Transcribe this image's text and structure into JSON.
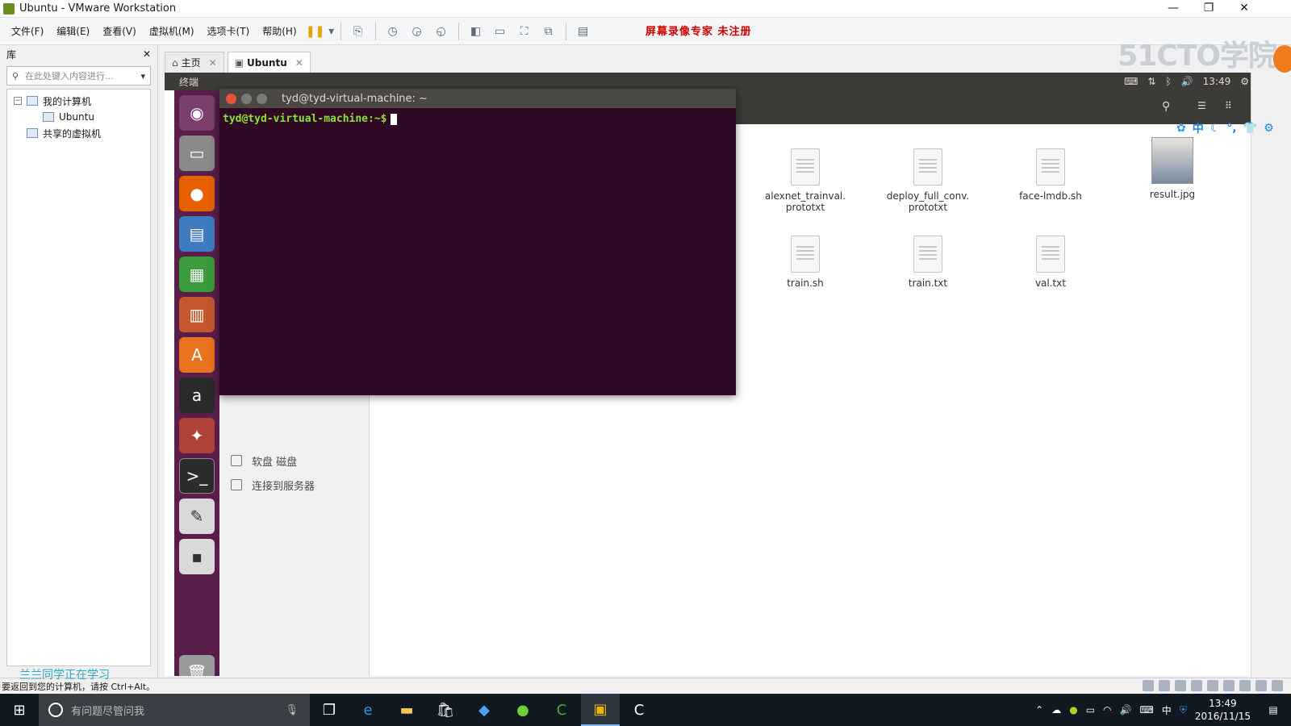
{
  "window": {
    "title": "Ubuntu - VMware Workstation",
    "controls": [
      "—",
      "❐",
      "✕"
    ]
  },
  "menu": {
    "items": [
      "文件(F)",
      "编辑(E)",
      "查看(V)",
      "虚拟机(M)",
      "选项卡(T)",
      "帮助(H)"
    ],
    "recorder_text": "屏幕录像专家  未注册",
    "watermark": "51CTO学院"
  },
  "library": {
    "title": "库",
    "close": "✕",
    "search_placeholder": "在此处键入内容进行...",
    "tree": {
      "root": "我的计算机",
      "vm": "Ubuntu",
      "shared": "共享的虚拟机"
    }
  },
  "tabs": [
    {
      "label": "主页",
      "icon": "⌂"
    },
    {
      "label": "Ubuntu",
      "icon": "▣"
    }
  ],
  "ubuntu": {
    "top_app_name": "终端",
    "time": "13:49",
    "terminal_title": "tyd@tyd-virtual-machine: ~",
    "prompt": "tyd@tyd-virtual-machine:~$",
    "sidebar": [
      "软盘 磁盘",
      "连接到服务器"
    ],
    "files": [
      {
        "name": "alexnet_trainval.\nprototxt"
      },
      {
        "name": "deploy_full_conv.\nprototxt"
      },
      {
        "name": "face-lmdb.sh"
      },
      {
        "name": "result.jpg"
      },
      {
        "name": "train.sh"
      },
      {
        "name": "train.txt"
      },
      {
        "name": "val.txt"
      }
    ],
    "ime_label": "中"
  },
  "status": {
    "hint": "要返回到您的计算机，请按 Ctrl+Alt。",
    "overlay": "兰兰同学正在学习"
  },
  "taskbar": {
    "search_placeholder": "有问题尽管问我",
    "time": "13:49",
    "date": "2016/11/15",
    "ime": "中"
  }
}
